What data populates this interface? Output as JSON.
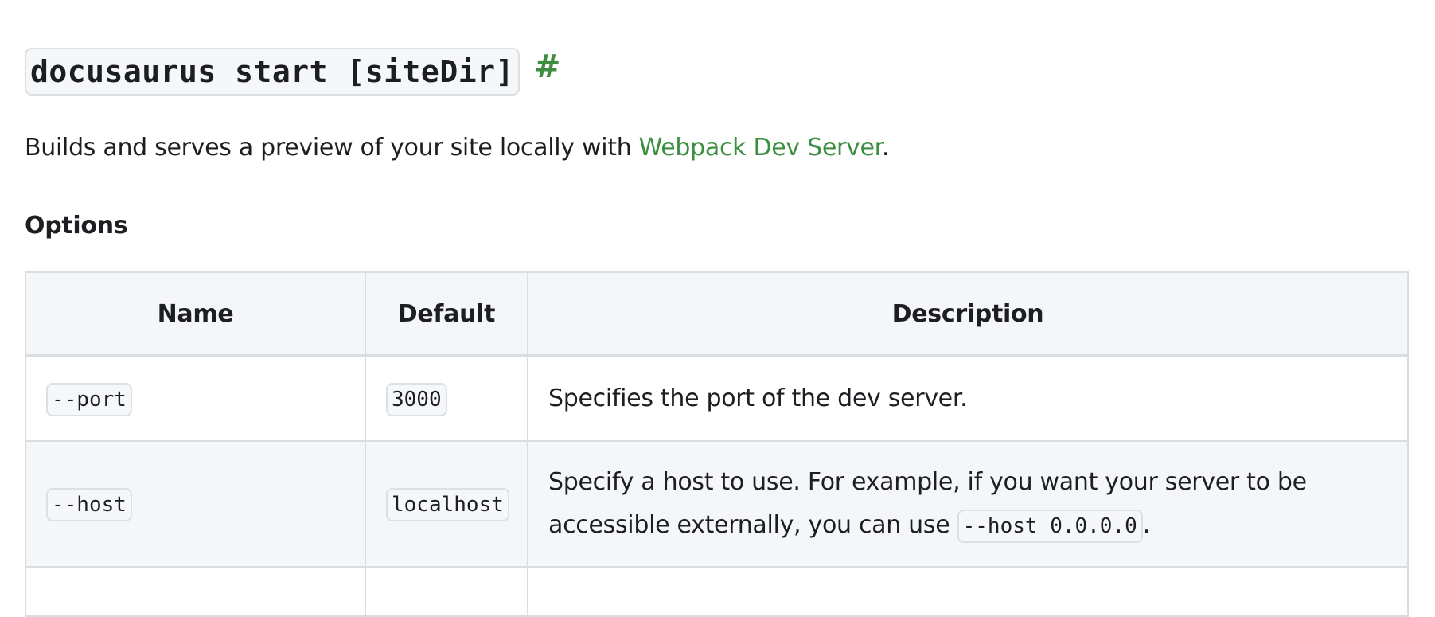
{
  "heading": {
    "command": "docusaurus start [siteDir]",
    "anchor": "#"
  },
  "intro": {
    "text_before": "Builds and serves a preview of your site locally with ",
    "link_text": "Webpack Dev Server",
    "text_after": "."
  },
  "options": {
    "title": "Options",
    "columns": [
      "Name",
      "Default",
      "Description"
    ],
    "rows": [
      {
        "name": "--port",
        "default": "3000",
        "description": "Specifies the port of the dev server."
      },
      {
        "name": "--host",
        "default": "localhost",
        "description_before": "Specify a host to use. For example, if you want your server to be accessible externally, you can use ",
        "description_code": "--host 0.0.0.0",
        "description_after": "."
      }
    ]
  },
  "colors": {
    "link": "#3e8e41",
    "text": "#1c1e21",
    "header_bg": "#f5f6f7",
    "border": "#dadde1",
    "code_bg": "#f6f7f8"
  }
}
